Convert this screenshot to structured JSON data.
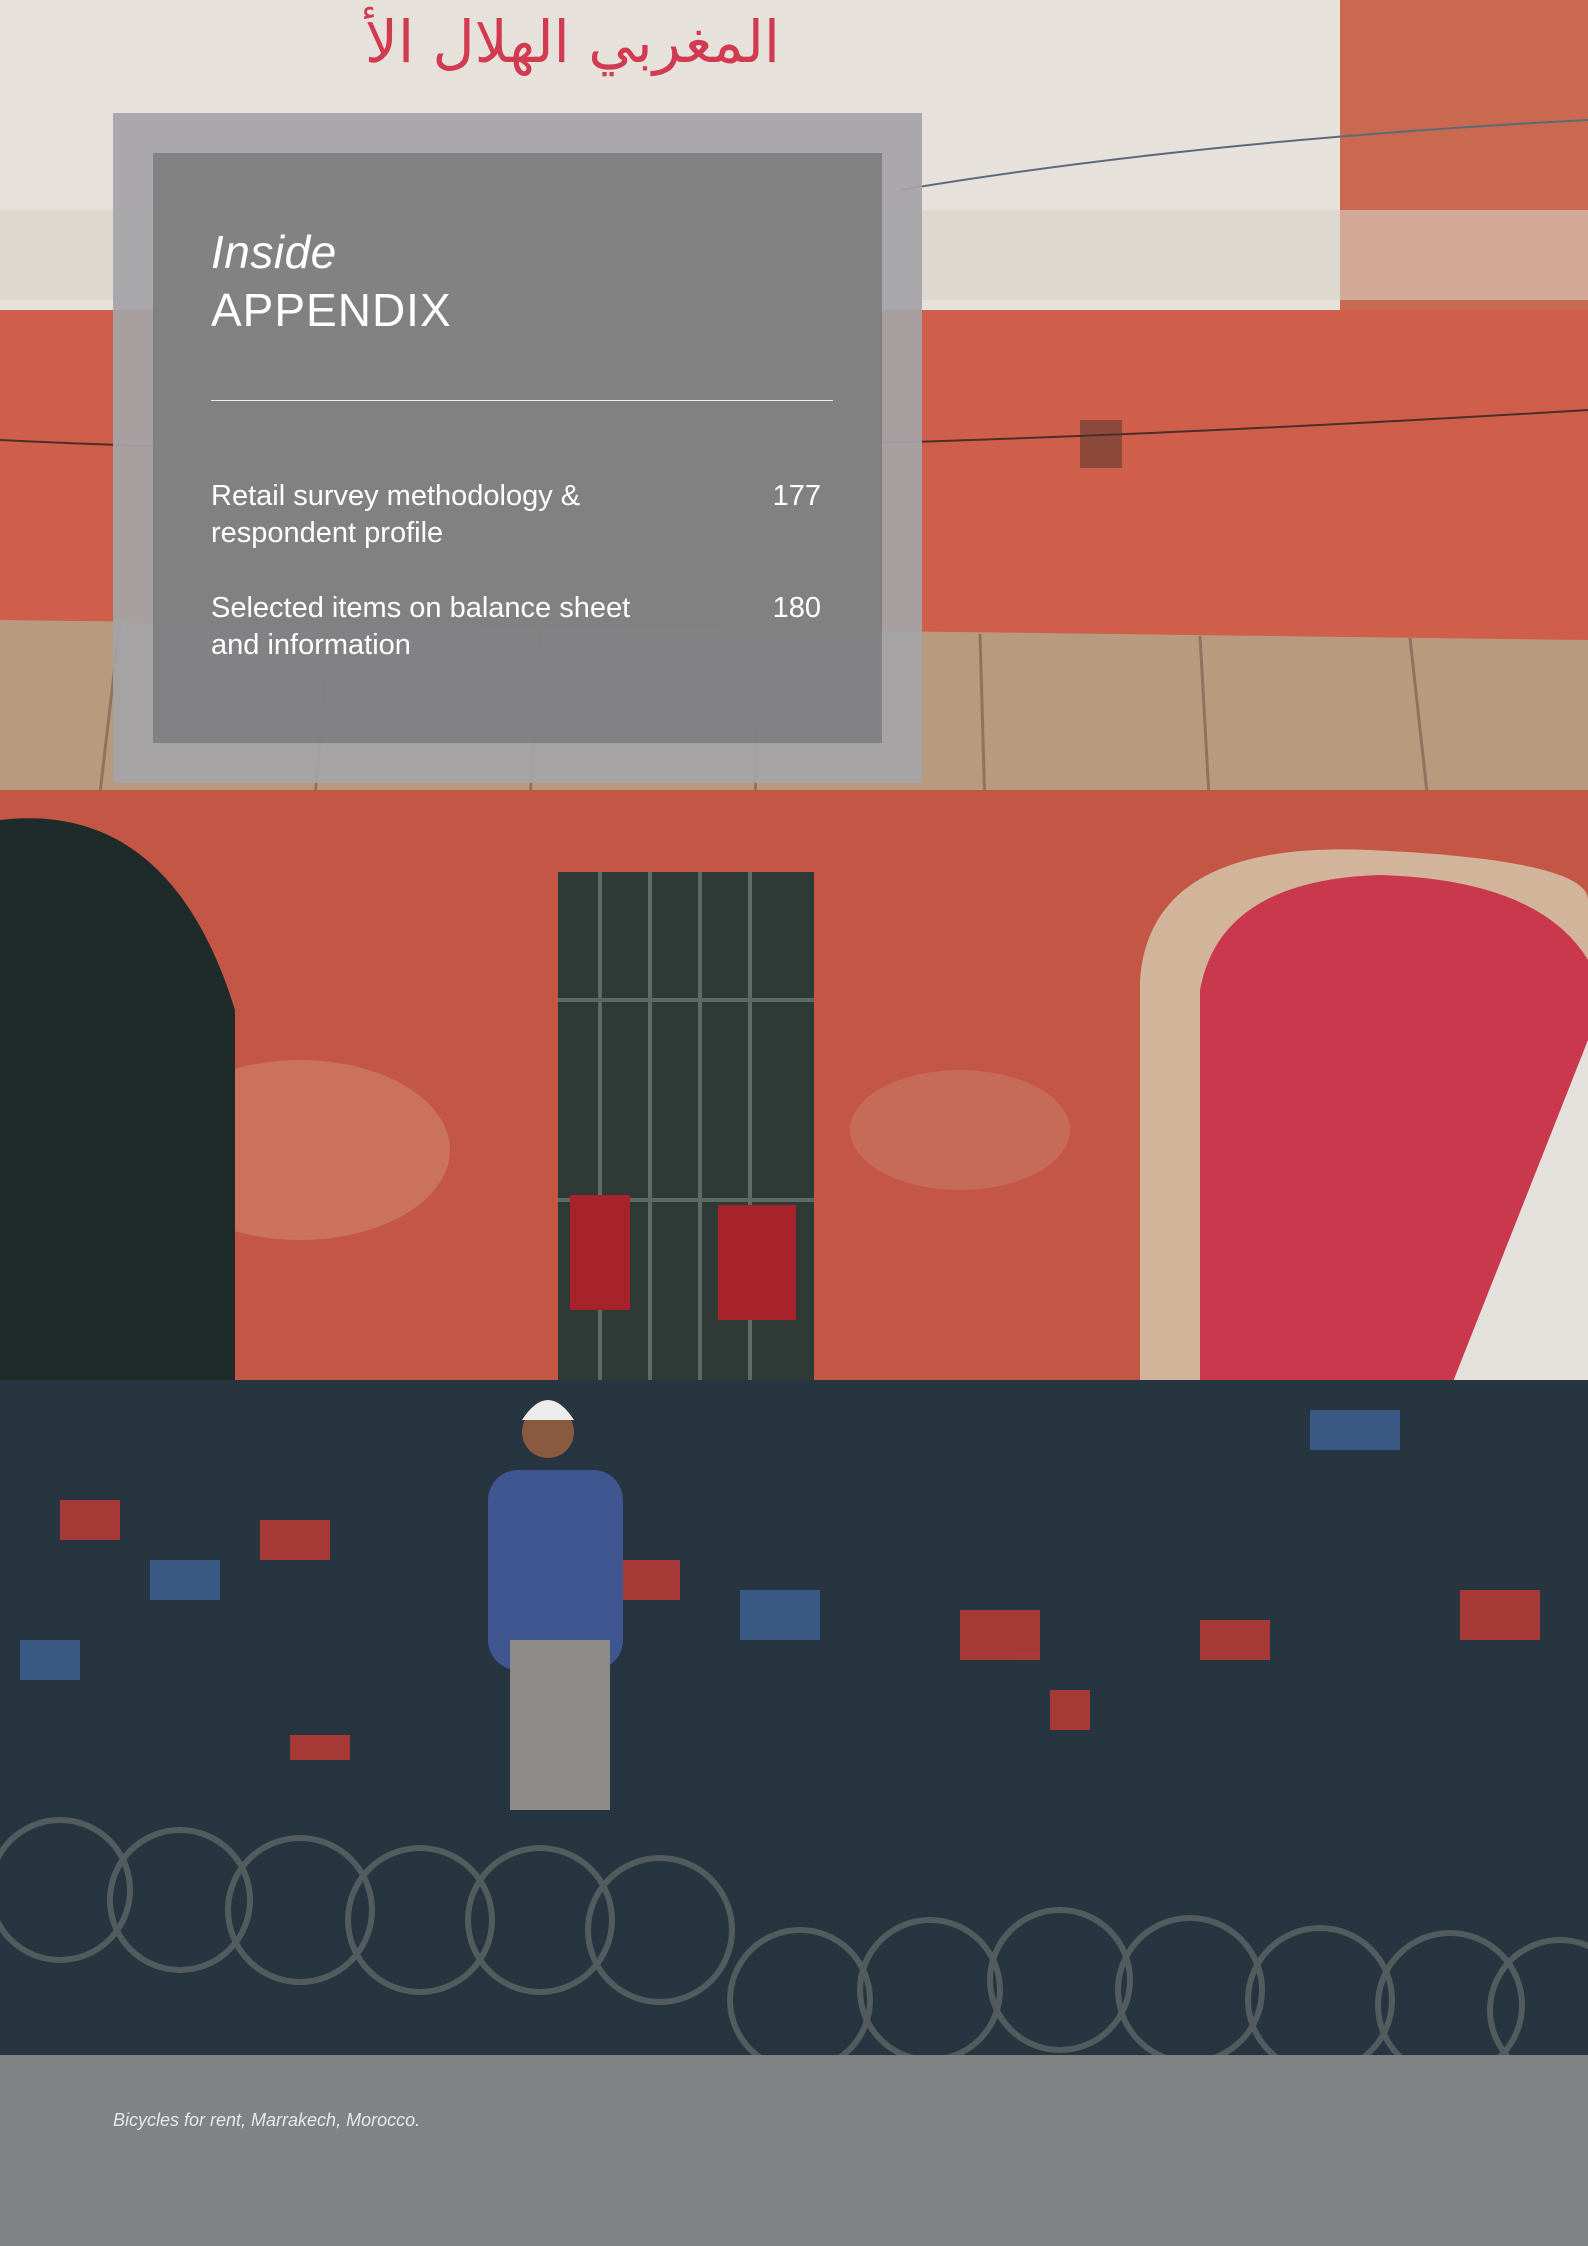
{
  "toc": {
    "kicker": "Inside",
    "title": "APPENDIX",
    "entries": [
      {
        "label": "Retail survey methodology & respondent profile",
        "page": "177"
      },
      {
        "label": "Selected items on balance sheet and information",
        "page": "180"
      }
    ]
  },
  "photo": {
    "caption": "Bicycles for rent, Marrakech, Morocco.",
    "sign_text": "المغربي   الهلال الأ"
  },
  "colors": {
    "wall_red": "#c85a47",
    "wall_white": "#e7e3dc",
    "door_red": "#c9384c",
    "awning": "#b89a7f",
    "ground": "#7f8383",
    "panel_outer": "#a5a4a8",
    "panel_inner": "#807f81"
  }
}
